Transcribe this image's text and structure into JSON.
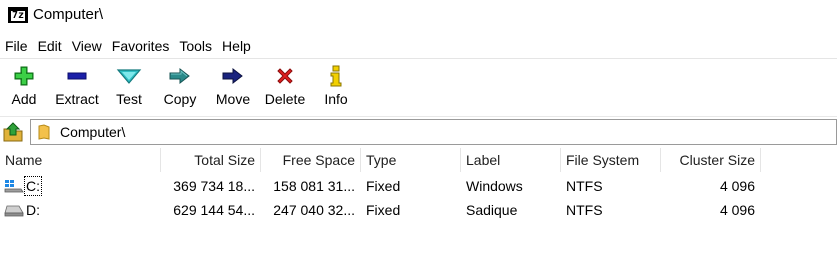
{
  "window": {
    "title": "Computer\\",
    "app_icon_text": "7z"
  },
  "menu": [
    "File",
    "Edit",
    "View",
    "Favorites",
    "Tools",
    "Help"
  ],
  "toolbar": {
    "add": "Add",
    "extract": "Extract",
    "test": "Test",
    "copy": "Copy",
    "move": "Move",
    "delete": "Delete",
    "info": "Info"
  },
  "address": {
    "path": "Computer\\"
  },
  "columns": {
    "name": "Name",
    "total_size": "Total Size",
    "free_space": "Free Space",
    "type": "Type",
    "label": "Label",
    "file_system": "File System",
    "cluster_size": "Cluster Size"
  },
  "drives": [
    {
      "name": "C:",
      "total_size": "369 734 18...",
      "free_space": "158 081 31...",
      "type": "Fixed",
      "label": "Windows",
      "file_system": "NTFS",
      "cluster_size": "4 096"
    },
    {
      "name": "D:",
      "total_size": "629 144 54...",
      "free_space": "247 040 32...",
      "type": "Fixed",
      "label": "Sadique",
      "file_system": "NTFS",
      "cluster_size": "4 096"
    }
  ],
  "colors": {
    "add": "#1fa02a",
    "extract": "#1b1fa8",
    "test": "#2fbfc4",
    "copy": "#2a8a8a",
    "move": "#1a237e",
    "delete": "#e02020",
    "info": "#c8a800"
  }
}
